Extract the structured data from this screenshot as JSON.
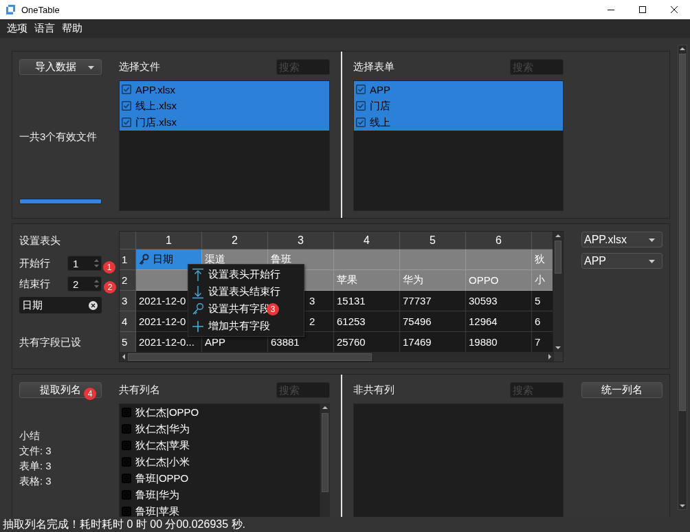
{
  "window": {
    "title": "OneTable"
  },
  "menu": [
    {
      "label": "选项"
    },
    {
      "label": "语言"
    },
    {
      "label": "帮助"
    }
  ],
  "import_panel": {
    "import_button": "导入数据",
    "summary": "一共3个有效文件",
    "progress": {
      "level": 1
    },
    "files": {
      "label": "选择文件",
      "search_placeholder": "搜索",
      "items": [
        {
          "label": "APP.xlsx",
          "checked": true,
          "selected": true
        },
        {
          "label": "线上.xlsx",
          "checked": true,
          "selected": true
        },
        {
          "label": "门店.xlsx",
          "checked": true,
          "selected": true
        }
      ]
    },
    "sheets": {
      "label": "选择表单",
      "search_placeholder": "搜索",
      "items": [
        {
          "label": "APP",
          "checked": true,
          "selected": true
        },
        {
          "label": "门店",
          "checked": true,
          "selected": true
        },
        {
          "label": "线上",
          "checked": true,
          "selected": true
        }
      ]
    }
  },
  "header_panel": {
    "title": "设置表头",
    "start_row": {
      "label": "开始行",
      "value": "1",
      "badge": "1"
    },
    "end_row": {
      "label": "结束行",
      "value": "2",
      "badge": "2"
    },
    "common_fields": [
      {
        "label": "日期"
      }
    ],
    "status": "共有字段已设",
    "table": {
      "columns": [
        "1",
        "2",
        "3",
        "4",
        "5",
        "6"
      ],
      "rows": [
        {
          "label": "1",
          "header": true,
          "cells": [
            {
              "text": "日期",
              "selected": true,
              "kind": "key"
            },
            {
              "text": "渠道"
            },
            {
              "text": "鲁班"
            },
            {},
            {},
            {},
            {
              "text": "狄"
            }
          ]
        },
        {
          "label": "2",
          "header": true,
          "cells": [
            {},
            {},
            {},
            {
              "text": "苹果"
            },
            {
              "text": "华为"
            },
            {
              "text": "OPPO"
            },
            {
              "text": "小"
            }
          ]
        },
        {
          "label": "3",
          "header": false,
          "cells": [
            {
              "text": "2021-12-0"
            },
            {},
            {
              "text": "3",
              "kind": "tail"
            },
            {
              "text": "15131"
            },
            {
              "text": "77737"
            },
            {
              "text": "30593"
            },
            {
              "text": "5"
            }
          ]
        },
        {
          "label": "4",
          "header": false,
          "cells": [
            {
              "text": "2021-12-0"
            },
            {},
            {
              "text": "2",
              "kind": "tail"
            },
            {
              "text": "61253"
            },
            {
              "text": "75496"
            },
            {
              "text": "12964"
            },
            {
              "text": "6"
            }
          ]
        },
        {
          "label": "5",
          "header": false,
          "cells": [
            {
              "text": "2021-12-0..."
            },
            {
              "text": "APP"
            },
            {
              "text": "63881"
            },
            {
              "text": "25760"
            },
            {
              "text": "17469"
            },
            {
              "text": "19880"
            },
            {
              "text": "7"
            }
          ]
        }
      ],
      "context_menu": [
        {
          "label": "设置表头开始行",
          "kind": "top"
        },
        {
          "label": "设置表头结束行",
          "kind": "bottom"
        },
        {
          "label": "设置共有字段",
          "kind": "key",
          "badge": "3"
        },
        {
          "label": "增加共有字段",
          "kind": "plus"
        }
      ]
    },
    "file_select": "APP.xlsx",
    "sheet_select": "APP"
  },
  "columns_panel": {
    "extract_button": "提取列名",
    "badge": "4",
    "summary": [
      "小结",
      "文件: 3",
      "表单: 3",
      "表格: 3"
    ],
    "common": {
      "label": "共有列名",
      "search_placeholder": "搜索",
      "items": [
        {
          "label": "狄仁杰|OPPO",
          "checked": false
        },
        {
          "label": "狄仁杰|华为",
          "checked": false
        },
        {
          "label": "狄仁杰|苹果",
          "checked": false
        },
        {
          "label": "狄仁杰|小米",
          "checked": false
        },
        {
          "label": "鲁班|OPPO",
          "checked": false
        },
        {
          "label": "鲁班|华为",
          "checked": false
        },
        {
          "label": "鲁班|苹果",
          "checked": false
        }
      ]
    },
    "unique": {
      "label": "非共有列",
      "search_placeholder": "搜索"
    },
    "unify_button": "统一列名"
  },
  "status_bar": "抽取列名完成！耗时耗时 0 时 00 分00.026935 秒."
}
